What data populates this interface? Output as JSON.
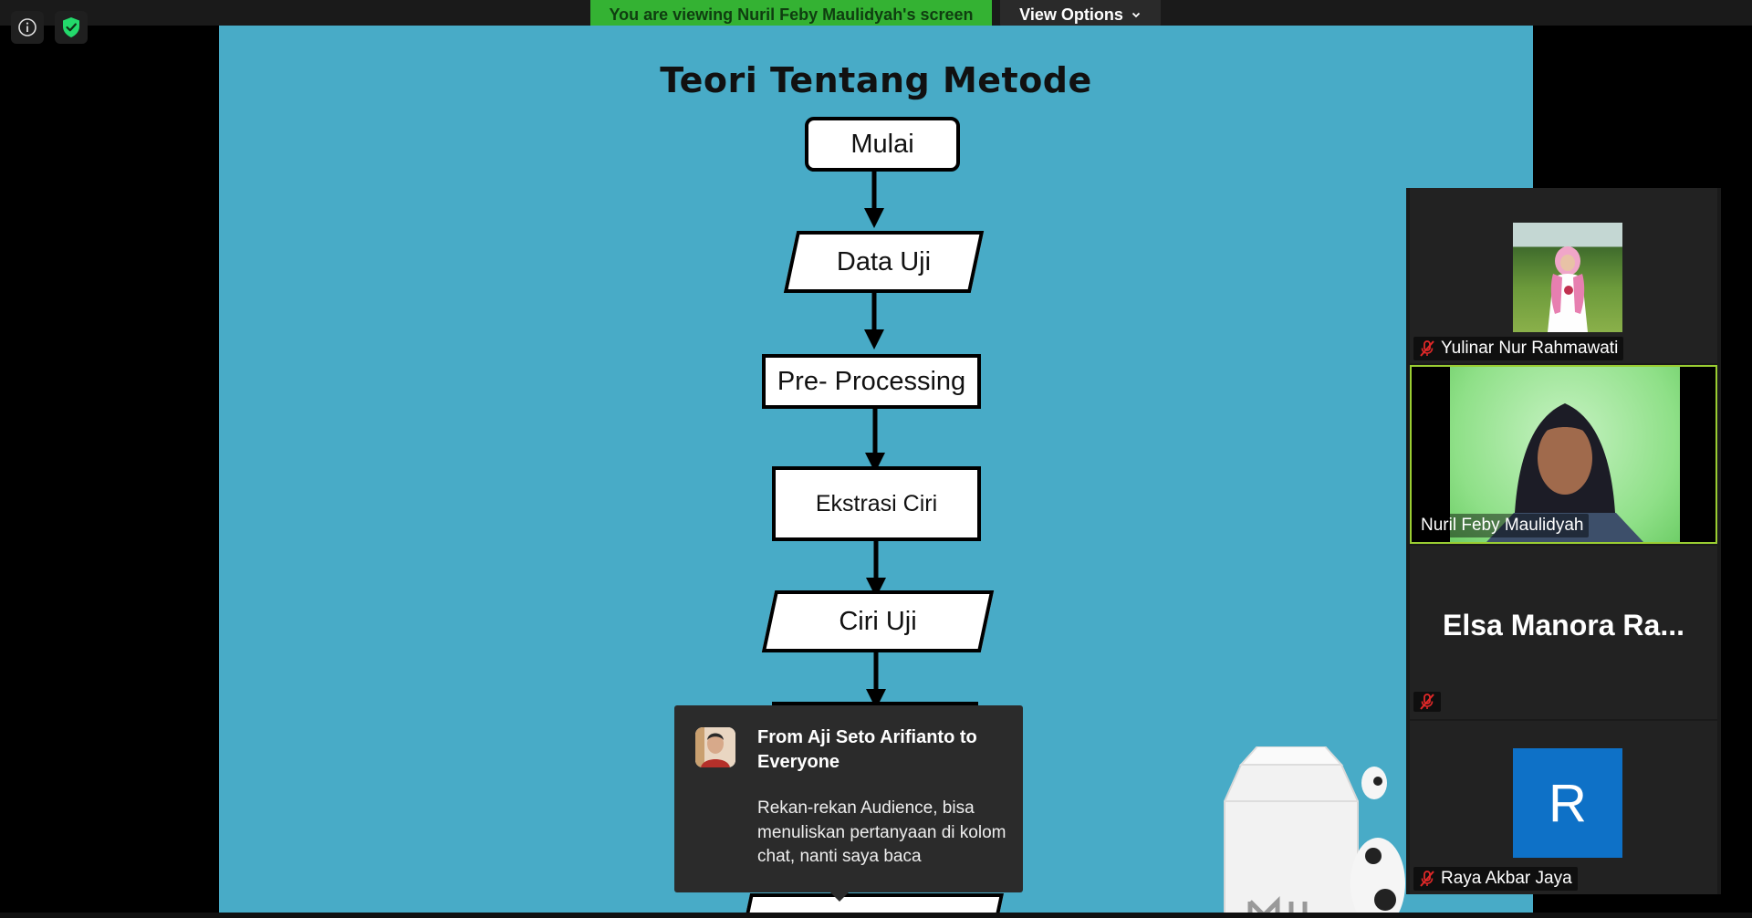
{
  "banner": {
    "viewing_text": "You are viewing Nuril Feby Maulidyah's screen",
    "view_options_label": "View Options"
  },
  "toolbar_icons": [
    "info-icon",
    "shield-check-icon"
  ],
  "slide": {
    "title": "Teori Tentang Metode",
    "steps": [
      "Mulai",
      "Data Uji",
      "Pre- Processing",
      "Ekstrasi Ciri",
      "Ciri Uji"
    ]
  },
  "gallery": {
    "participants": [
      {
        "name": "Yulinar Nur Rahmawati",
        "muted": true
      },
      {
        "name": "Nuril Feby Maulidyah",
        "muted": false,
        "active_speaker": true
      },
      {
        "display_name": "Elsa Manora Ra...",
        "muted": true
      },
      {
        "name": "Raya Akbar Jaya",
        "muted": true,
        "avatar_letter": "R"
      }
    ]
  },
  "chat_notification": {
    "sender": "From Aji Seto Arifianto to Everyone",
    "message": "Rekan-rekan Audience, bisa menuliskan pertanyaan di kolom chat, nanti saya baca"
  },
  "colors": {
    "slide_bg": "#48abc7",
    "banner_green": "#34b233",
    "active_border": "#9acd32",
    "avatar_blue": "#0e71c7",
    "mute_red": "#e02828"
  }
}
